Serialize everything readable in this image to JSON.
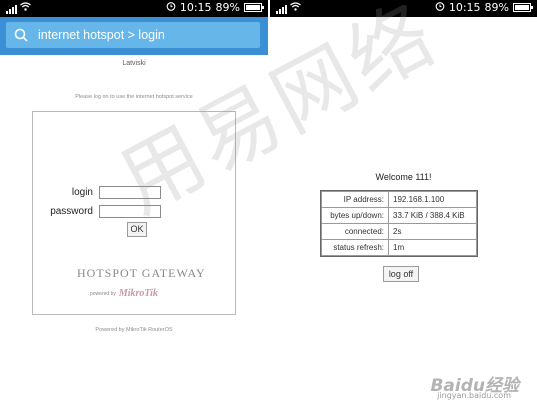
{
  "left": {
    "status": {
      "time": "10:15",
      "battery": "89%",
      "battery_level": 0.89
    },
    "search": {
      "text": "internet hotspot > login"
    },
    "language": "Latviski",
    "notice": "Please log on to use the internet hotspot service",
    "form": {
      "login_label": "login",
      "password_label": "password",
      "login_value": "",
      "password_value": "",
      "ok_label": "OK"
    },
    "brand": "HOTSPOT GATEWAY",
    "powered_prefix": "powered by",
    "powered_logo": "MikroTik",
    "footer": "Powered by MikroTik RouterOS"
  },
  "right": {
    "status": {
      "time": "10:15",
      "battery": "89%",
      "battery_level": 0.89
    },
    "welcome": "Welcome 111!",
    "stats": [
      {
        "key": "IP address:",
        "value": "192.168.1.100"
      },
      {
        "key": "bytes up/down:",
        "value": "33.7 KiB / 388.4 KiB"
      },
      {
        "key": "connected:",
        "value": "2s"
      },
      {
        "key": "status refresh:",
        "value": "1m"
      }
    ],
    "logoff_label": "log off"
  },
  "watermark": {
    "text": "用易网络"
  },
  "baidu": {
    "logo": "Baidu经验",
    "url": "jingyan.baidu.com"
  },
  "colors": {
    "search_bar": "#3b8fd5",
    "search_box": "#66b6ea",
    "status_bar": "#000000"
  }
}
